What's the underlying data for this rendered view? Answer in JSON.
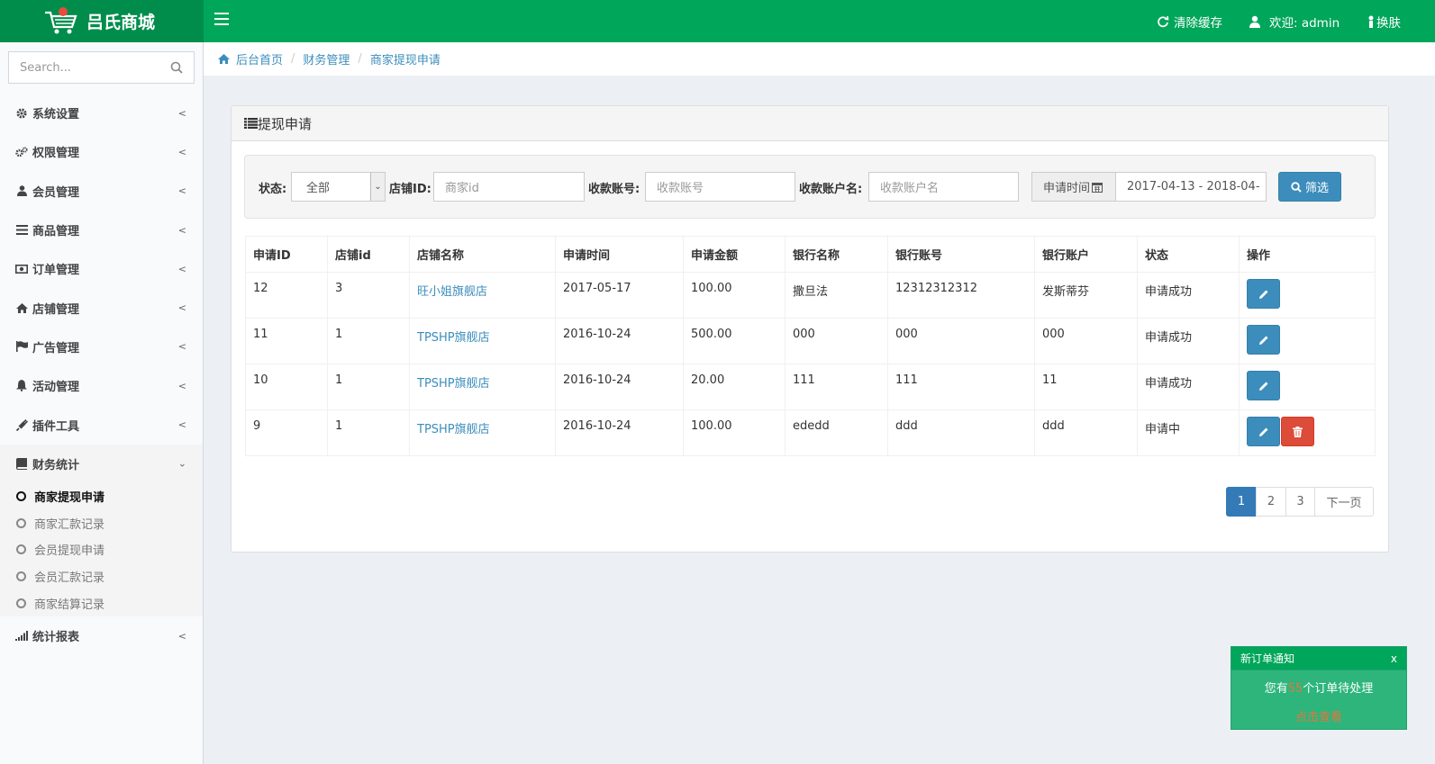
{
  "header": {
    "brand": "吕氏商城",
    "clear_cache": "清除缓存",
    "welcome": "欢迎: admin",
    "skin": "换肤"
  },
  "sidebar": {
    "search_placeholder": "Search...",
    "menu": [
      {
        "label": "系统设置",
        "icon": "gear-icon"
      },
      {
        "label": "权限管理",
        "icon": "gears-icon"
      },
      {
        "label": "会员管理",
        "icon": "user-icon"
      },
      {
        "label": "商品管理",
        "icon": "list-icon"
      },
      {
        "label": "订单管理",
        "icon": "money-icon"
      },
      {
        "label": "店铺管理",
        "icon": "home-icon"
      },
      {
        "label": "广告管理",
        "icon": "flag-icon"
      },
      {
        "label": "活动管理",
        "icon": "bell-icon"
      },
      {
        "label": "插件工具",
        "icon": "plug-icon"
      },
      {
        "label": "财务统计",
        "icon": "book-icon"
      }
    ],
    "finance_sub": [
      {
        "label": "商家提现申请",
        "active": true
      },
      {
        "label": "商家汇款记录",
        "active": false
      },
      {
        "label": "会员提现申请",
        "active": false
      },
      {
        "label": "会员汇款记录",
        "active": false
      },
      {
        "label": "商家结算记录",
        "active": false
      }
    ],
    "report": {
      "label": "统计报表",
      "icon": "bar-chart-icon"
    }
  },
  "breadcrumb": [
    "后台首页",
    "财务管理",
    "商家提现申请"
  ],
  "panel": {
    "title": "提现申请"
  },
  "filter": {
    "status_label": "状态:",
    "status_value": "全部",
    "shop_id_label": "店铺ID:",
    "shop_id_placeholder": "商家id",
    "account_label": "收款账号:",
    "account_placeholder": "收款账号",
    "account_name_label": "收款账户名:",
    "account_name_placeholder": "收款账户名",
    "date_label": "申请时间",
    "date_value": "2017-04-13 - 2018-04-",
    "submit": "筛选"
  },
  "table": {
    "headers": [
      "申请ID",
      "店铺id",
      "店铺名称",
      "申请时间",
      "申请金额",
      "银行名称",
      "银行账号",
      "银行账户",
      "状态",
      "操作"
    ],
    "rows": [
      {
        "id": "12",
        "shop_id": "3",
        "shop_name": "旺小姐旗舰店",
        "time": "2017-05-17",
        "amount": "100.00",
        "bank": "撒旦法",
        "account": "12312312312",
        "holder": "发斯蒂芬",
        "status": "申请成功",
        "deletable": false
      },
      {
        "id": "11",
        "shop_id": "1",
        "shop_name": "TPSHP旗舰店",
        "time": "2016-10-24",
        "amount": "500.00",
        "bank": "000",
        "account": "000",
        "holder": "000",
        "status": "申请成功",
        "deletable": false
      },
      {
        "id": "10",
        "shop_id": "1",
        "shop_name": "TPSHP旗舰店",
        "time": "2016-10-24",
        "amount": "20.00",
        "bank": "111",
        "account": "111",
        "holder": "11",
        "status": "申请成功",
        "deletable": false
      },
      {
        "id": "9",
        "shop_id": "1",
        "shop_name": "TPSHP旗舰店",
        "time": "2016-10-24",
        "amount": "100.00",
        "bank": "ededd",
        "account": "ddd",
        "holder": "ddd",
        "status": "申请中",
        "deletable": true
      }
    ]
  },
  "pagination": [
    "1",
    "2",
    "3",
    "下一页"
  ],
  "notice": {
    "title": "新订单通知",
    "close": "x",
    "text_before": "您有",
    "count": "55",
    "text_after": "个订单待处理",
    "link": "点击查看"
  },
  "colors": {
    "header_green": "#00a65a",
    "logo_green": "#008d4c",
    "primary_blue": "#3c8dbc",
    "danger_red": "#dd4b39"
  }
}
